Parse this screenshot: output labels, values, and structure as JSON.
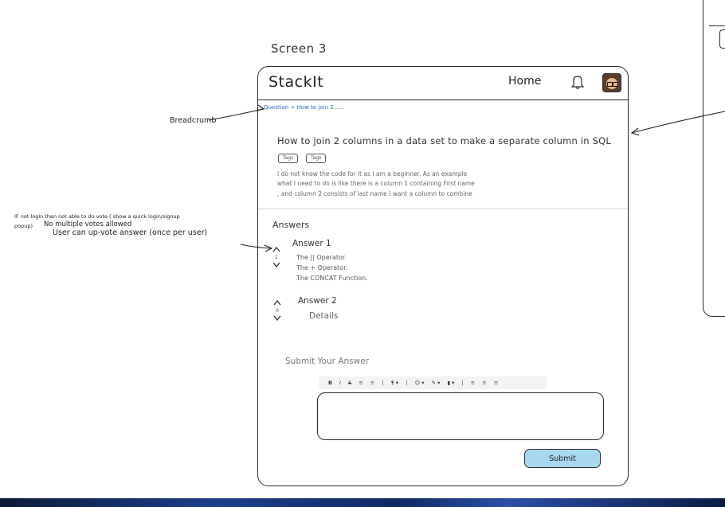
{
  "screen_label": "Screen 3",
  "header": {
    "brand": "StackIt",
    "home_label": "Home"
  },
  "breadcrumb": "Question > How to join 2......",
  "question": {
    "title": "How to join 2 columns in a data set to make a separate column in SQL",
    "tags": [
      "Tags",
      "Tags"
    ],
    "description_lines": [
      "I do not know the code for it as I am a beginner. As an example",
      "what I need to do is like there is a column 1 containing First name",
      ", and column 2 consists of last name I want a column to combine"
    ]
  },
  "answers": {
    "heading": "Answers",
    "items": [
      {
        "title": "Answer 1",
        "votes": "1",
        "lines": [
          "The || Operator.",
          "The + Operator.",
          "The CONCAT Function."
        ]
      },
      {
        "title": "Answer 2",
        "votes": "0",
        "lines": [
          "Details"
        ]
      }
    ]
  },
  "submit": {
    "heading": "Submit Your Answer",
    "toolbar": [
      "B",
      "I",
      "S",
      "≡",
      "≡",
      "|",
      "¶ ▾",
      "|",
      "☺ ▾",
      "✎ ▾",
      "▮ ▾",
      "|",
      "≡",
      "≡",
      "≡"
    ],
    "button_label": "Submit"
  },
  "annotations": {
    "breadcrumb_note": "Breadcrumb",
    "vote_note_line1": "IF not login then not able to do vote ( show a quick login/signup",
    "vote_note_line2_prefix": "popup)",
    "vote_note_line2": "No multiple votes allowed",
    "vote_note_line3": "User can up-vote answer (once per user)"
  },
  "colors": {
    "link": "#2b6cc4",
    "submit_fill": "#a6d8f2",
    "stroke": "#2a2a2a"
  }
}
